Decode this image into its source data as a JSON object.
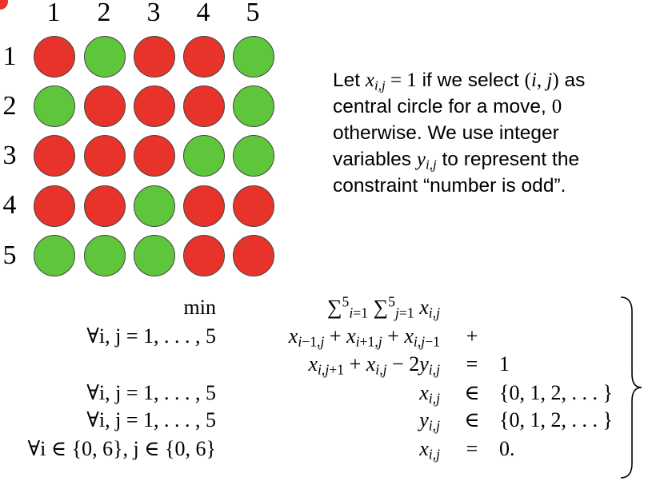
{
  "grid": {
    "column_labels": [
      "1",
      "2",
      "3",
      "4",
      "5"
    ],
    "row_labels": [
      "1",
      "2",
      "3",
      "4",
      "5"
    ],
    "colors": {
      "red": "#e8332a",
      "green": "#5ec63a"
    },
    "cells": [
      [
        "red",
        "green",
        "red",
        "red",
        "green"
      ],
      [
        "green",
        "red",
        "red",
        "red",
        "green"
      ],
      [
        "red",
        "red",
        "red",
        "green",
        "green"
      ],
      [
        "red",
        "red",
        "green",
        "red",
        "red"
      ],
      [
        "green",
        "green",
        "green",
        "red",
        "red"
      ]
    ]
  },
  "description": {
    "let": "Let ",
    "if_we_select": " if we select ",
    "as_central": " as central circle for a move, ",
    "zero": "0",
    "otherwise": " otherwise. We use integer variables ",
    "to_represent": " to represent the constraint “number is odd”."
  },
  "model": {
    "min": "min",
    "forall_ij": "∀i, j = 1, . . . , 5",
    "forall_boundary": "∀i ∈ {0, 6}, j ∈ {0, 6}",
    "eq": "=",
    "in": "∈",
    "plus": "+",
    "one": "1",
    "domain_set": "{0, 1, 2, . . . }",
    "zero_dot": "0."
  }
}
